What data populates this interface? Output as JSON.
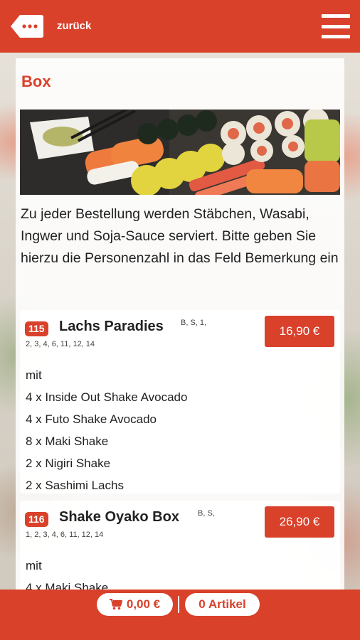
{
  "header": {
    "back_label": "zurück"
  },
  "section": {
    "title": "Box",
    "intro": "Zu jeder Bestellung werden Stäbchen, Wasabi, Ingwer und Soja-Sauce serviert. Bitte geben Sie hierzu die Personenzahl in das Feld Bemerkung ein"
  },
  "items": [
    {
      "nr": "115",
      "name": "Lachs Paradies",
      "tags_line1": "B, S, 1,",
      "tags_line2": "2, 3, 4, 6, 11, 12, 14",
      "price": "16,90 €",
      "lines": [
        "mit",
        "4 x Inside Out Shake Avocado",
        "4 x Futo Shake Avocado",
        "8 x Maki Shake",
        "2 x Nigiri Shake",
        "2 x Sashimi Lachs"
      ]
    },
    {
      "nr": "116",
      "name": "Shake Oyako Box",
      "tags_line1": "B, S,",
      "tags_line2": "1, 2, 3, 4, 6, 11, 12, 14",
      "price": "26,90 €",
      "lines": [
        "mit",
        "4 x Maki Shake"
      ]
    }
  ],
  "footer": {
    "cart_total": "0,00 €",
    "articles": "0 Artikel"
  },
  "colors": {
    "accent": "#d9412b"
  }
}
